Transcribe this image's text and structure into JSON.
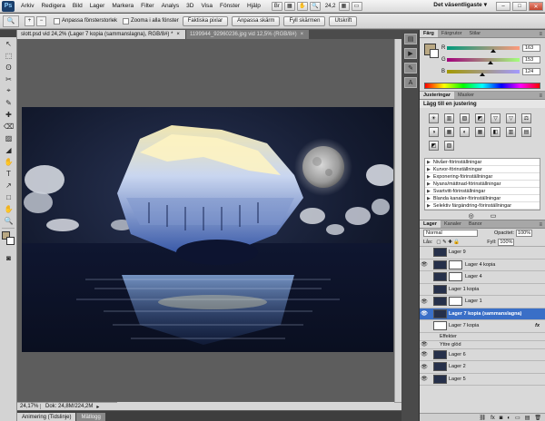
{
  "menubar": {
    "logo": "Ps",
    "items": [
      "Arkiv",
      "Redigera",
      "Bild",
      "Lager",
      "Markera",
      "Filter",
      "Analys",
      "3D",
      "Visa",
      "Fönster",
      "Hjälp"
    ],
    "zoom": "24,2",
    "workspace": "Det väsentligaste",
    "window_controls": [
      "–",
      "□",
      "✕"
    ]
  },
  "options_bar": {
    "resize_windows": "Anpassa fönsterstorlek",
    "zoom_all": "Zooma i alla fönster",
    "buttons": [
      "Faktiska pixlar",
      "Anpassa skärm",
      "Fyll skärmen",
      "Utskrift"
    ]
  },
  "documents": {
    "tabs": [
      {
        "label": "slott.psd vid 24,2% (Lager 7 kopia (sammanslagna), RGB/8#) *",
        "close": "×"
      },
      {
        "label": "1199944_92960236.jpg vid 12,5% (RGB/8#)",
        "close": "×"
      }
    ],
    "status_zoom": "24,17%",
    "status_doc": "Dok: 24,8M/224,2M",
    "bottom_tabs": [
      "Animering (Tidslinje)",
      "Mätlogg"
    ]
  },
  "color_panel": {
    "tabs": [
      "Färg",
      "Färgrutor",
      "Stilar"
    ],
    "rows": [
      {
        "label": "R",
        "value": "163",
        "pos": 0.64,
        "gradient": "linear-gradient(90deg,#009a7c,#ff9a7c)"
      },
      {
        "label": "G",
        "value": "153",
        "pos": 0.6,
        "gradient": "linear-gradient(90deg,#a3007c,#a3ff7c)"
      },
      {
        "label": "B",
        "value": "124",
        "pos": 0.49,
        "gradient": "linear-gradient(90deg,#a39900,#a399ff)"
      }
    ],
    "foreground": "#b9a883"
  },
  "adjustments_panel": {
    "tabs": [
      "Justeringar",
      "Masker"
    ],
    "title": "Lägg till en justering",
    "icons": [
      "☀",
      "▥",
      "▨",
      "◩",
      "▽",
      "▽",
      "⚖",
      "◑",
      "▦",
      "◐",
      "▦",
      "◧",
      "▥",
      "▤",
      "◩",
      "▧"
    ],
    "presets": [
      "Nivåer-förinställningar",
      "Kurvor-förinställningar",
      "Exponering-förinställningar",
      "Nyans/mättnad-förinställningar",
      "Svartvitt-förinställningar",
      "Blanda kanaler-förinställningar",
      "Selektiv färgändring-förinställningar"
    ],
    "footer_icons": [
      "◎",
      "▭"
    ]
  },
  "layers_panel": {
    "tabs": [
      "Lager",
      "Kanaler",
      "Banor"
    ],
    "blend_mode": "Normal",
    "opacity_label": "Opacitet:",
    "opacity": "100%",
    "lock_label": "Lås:",
    "fill_label": "Fyll:",
    "fill": "100%",
    "layers": [
      {
        "name": "Lager 9",
        "visible": false,
        "thumb": "dark",
        "mask": false,
        "fx": false,
        "selected": false,
        "sub": false
      },
      {
        "name": "Lager 4 kopia",
        "visible": true,
        "thumb": "dark",
        "mask": true,
        "fx": false,
        "selected": false,
        "sub": false
      },
      {
        "name": "Lager 4",
        "visible": false,
        "thumb": "dark",
        "mask": true,
        "fx": false,
        "selected": false,
        "sub": false
      },
      {
        "name": "Lager 1 kopia",
        "visible": false,
        "thumb": "dark",
        "mask": false,
        "fx": false,
        "selected": false,
        "sub": false
      },
      {
        "name": "Lager 1",
        "visible": true,
        "thumb": "dark",
        "mask": true,
        "fx": false,
        "selected": false,
        "sub": false
      },
      {
        "name": "Lager 7 kopia (sammanslagna)",
        "visible": true,
        "thumb": "dark",
        "mask": false,
        "fx": false,
        "selected": true,
        "sub": false
      },
      {
        "name": "Lager 7 kopia",
        "visible": false,
        "thumb": "white",
        "mask": false,
        "fx": true,
        "selected": false,
        "sub": false
      },
      {
        "name": "Effekter",
        "visible": false,
        "thumb": "none",
        "mask": false,
        "fx": false,
        "selected": false,
        "sub": true
      },
      {
        "name": "Yttre glöd",
        "visible": true,
        "thumb": "none",
        "mask": false,
        "fx": false,
        "selected": false,
        "sub": true
      },
      {
        "name": "Lager 6",
        "visible": true,
        "thumb": "dark",
        "mask": false,
        "fx": false,
        "selected": false,
        "sub": false
      },
      {
        "name": "Lager 2",
        "visible": true,
        "thumb": "dark",
        "mask": false,
        "fx": false,
        "selected": false,
        "sub": false
      },
      {
        "name": "Lager 5",
        "visible": true,
        "thumb": "dark",
        "mask": false,
        "fx": false,
        "selected": false,
        "sub": false
      }
    ],
    "fx_label": "fx",
    "footer_icons": [
      "⛓",
      "fx",
      "◙",
      "◐",
      "▭",
      "▤",
      "🗑"
    ]
  },
  "tools": [
    "↖",
    "⬚",
    "ʘ",
    "✂",
    "⌖",
    "✎",
    "✚",
    "⌫",
    "▨",
    "◢",
    "✋",
    "T",
    "↗",
    "□",
    "✋",
    "🔍"
  ]
}
